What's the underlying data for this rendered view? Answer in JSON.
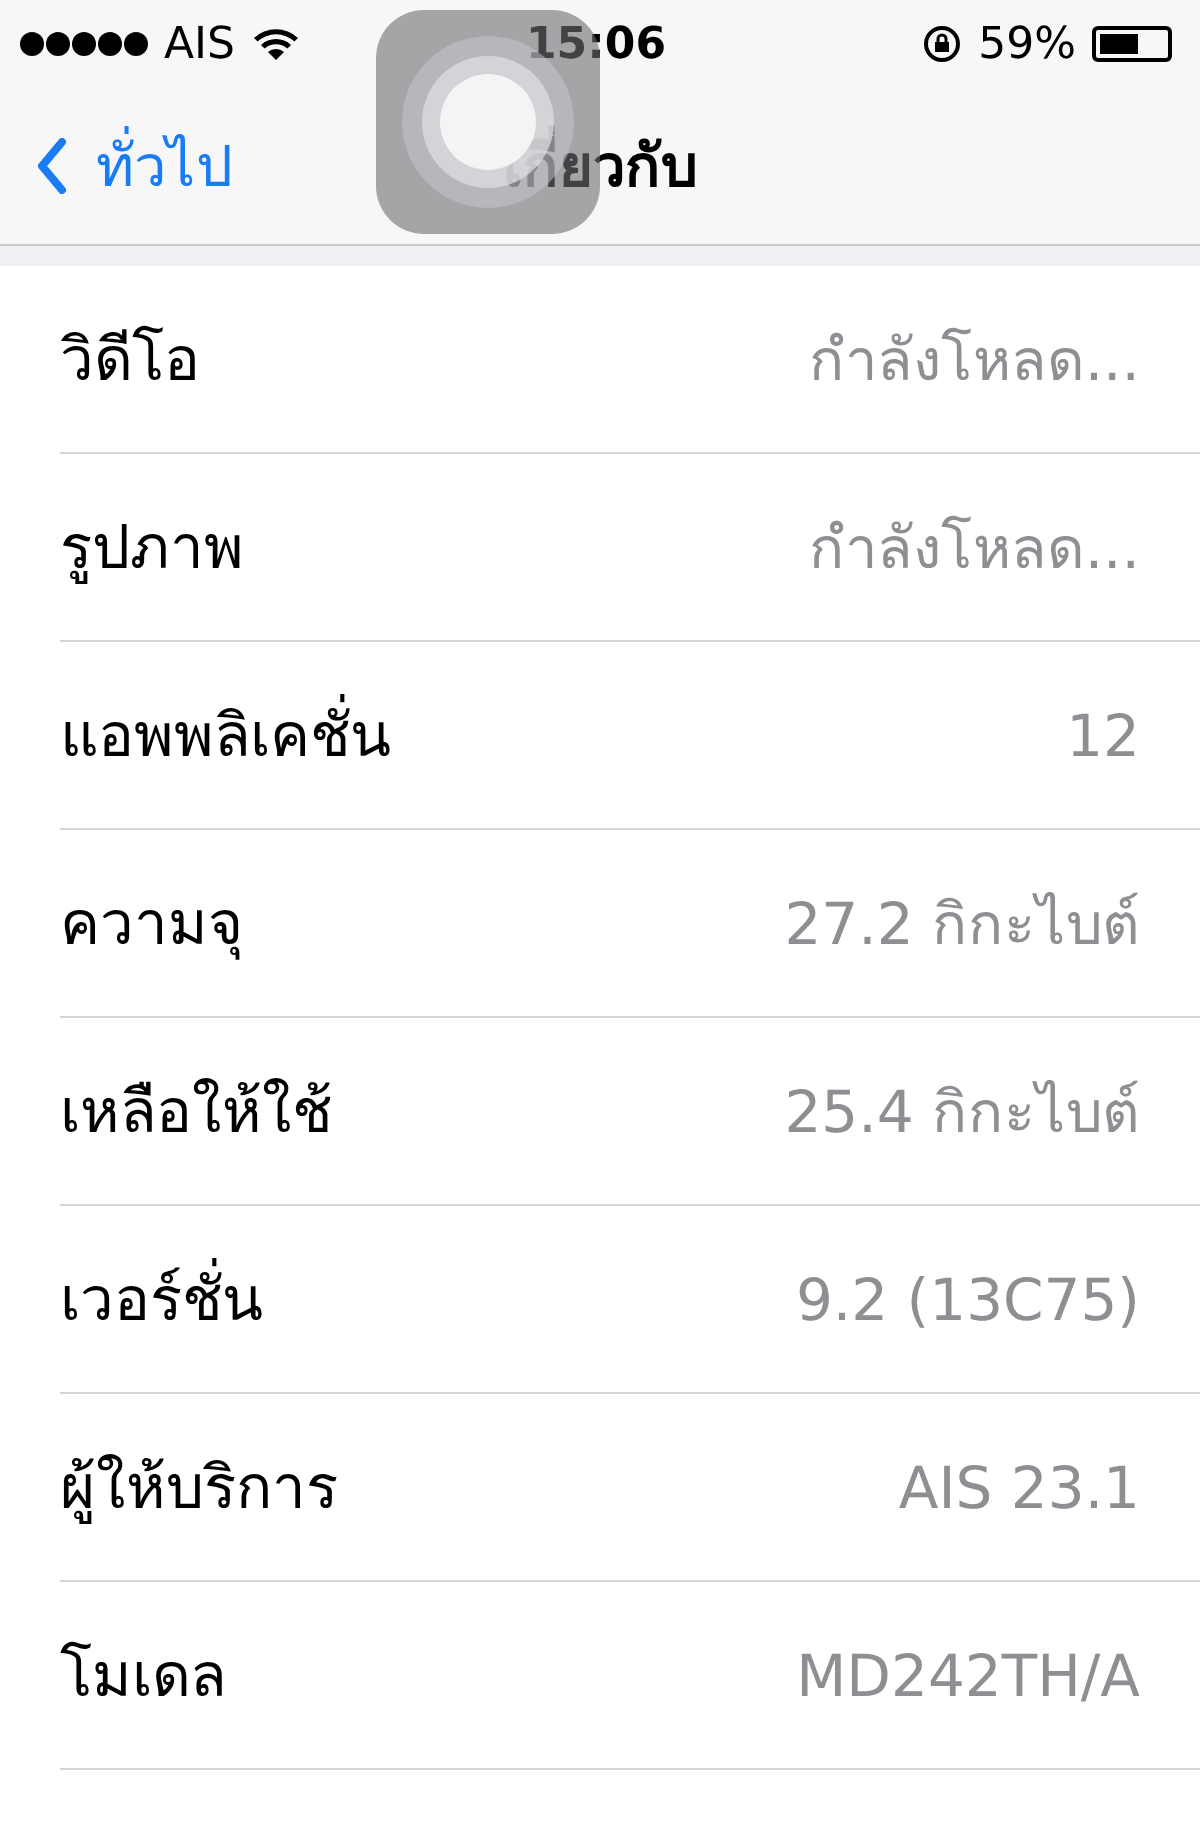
{
  "status_bar": {
    "carrier": "AIS",
    "time": "15:06",
    "battery": "59%"
  },
  "nav": {
    "back": "ทั่วไป",
    "title": "เกี่ยวกับ"
  },
  "rows": [
    {
      "label": "วิดีโอ",
      "value": "กำลังโหลด..."
    },
    {
      "label": "รูปภาพ",
      "value": "กำลังโหลด..."
    },
    {
      "label": "แอพพลิเคชั่น",
      "value": "12"
    },
    {
      "label": "ความจุ",
      "value": "27.2 กิกะไบต์"
    },
    {
      "label": "เหลือให้ใช้",
      "value": "25.4 กิกะไบต์"
    },
    {
      "label": "เวอร์ชั่น",
      "value": "9.2 (13C75)"
    },
    {
      "label": "ผู้ให้บริการ",
      "value": "AIS 23.1"
    },
    {
      "label": "โมเดล",
      "value": "MD242TH/A"
    }
  ]
}
